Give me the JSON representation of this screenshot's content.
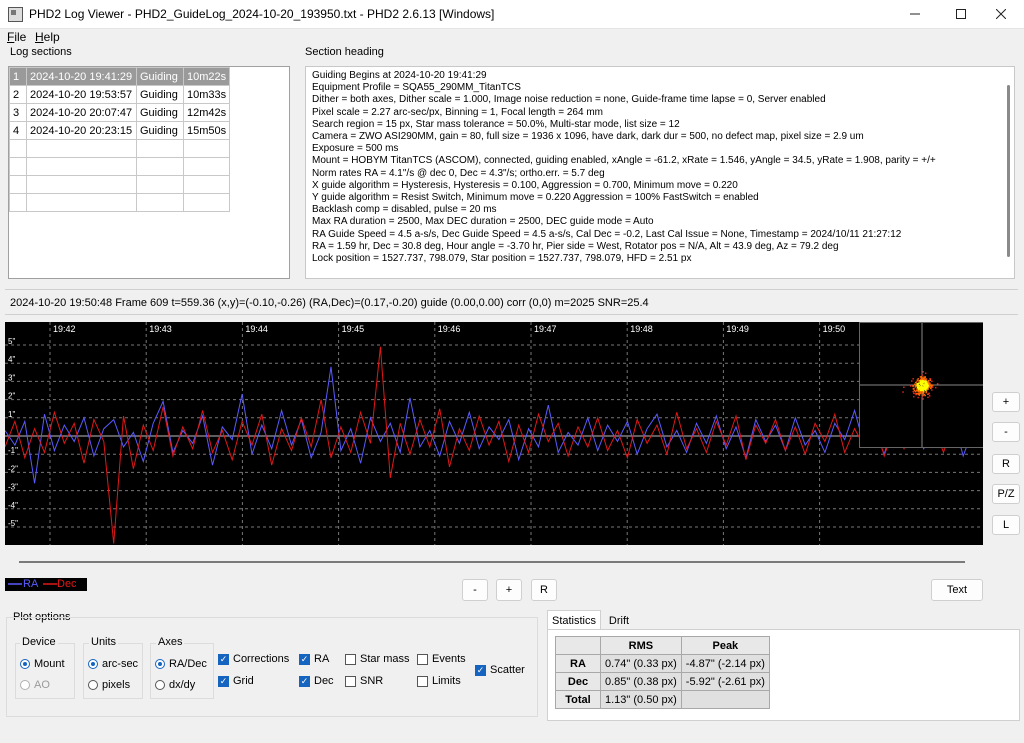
{
  "window": {
    "title": "PHD2 Log Viewer - PHD2_GuideLog_2024-10-20_193950.txt - PHD2 2.6.13 [Windows]",
    "minimize_icon": "minimize-icon",
    "maximize_icon": "maximize-icon",
    "close_icon": "close-icon"
  },
  "menu": {
    "file_rest": "ile",
    "file_key": "F",
    "help_rest": "elp",
    "help_key": "H"
  },
  "log_sections": {
    "label": "Log sections",
    "rows": [
      {
        "num": "1",
        "date": "2024-10-20 19:41:29",
        "type": "Guiding",
        "dur": "10m22s"
      },
      {
        "num": "2",
        "date": "2024-10-20 19:53:57",
        "type": "Guiding",
        "dur": "10m33s"
      },
      {
        "num": "3",
        "date": "2024-10-20 20:07:47",
        "type": "Guiding",
        "dur": "12m42s"
      },
      {
        "num": "4",
        "date": "2024-10-20 20:23:15",
        "type": "Guiding",
        "dur": "15m50s"
      }
    ]
  },
  "section_heading": {
    "label": "Section heading",
    "lines": [
      "Guiding Begins at 2024-10-20 19:41:29",
      "Equipment Profile = SQA55_290MM_TitanTCS",
      "Dither = both axes, Dither scale = 1.000, Image noise reduction = none, Guide-frame time lapse = 0, Server enabled",
      "Pixel scale = 2.27 arc-sec/px, Binning = 1, Focal length = 264 mm",
      "Search region = 15 px, Star mass tolerance = 50.0%, Multi-star mode, list size = 12",
      " Camera = ZWO ASI290MM, gain = 80, full size = 1936 x 1096, have dark, dark dur = 500, no defect map, pixel size = 2.9 um",
      "Exposure = 500 ms",
      "Mount = HOBYM TitanTCS (ASCOM), connected, guiding enabled, xAngle = -61.2, xRate = 1.546, yAngle = 34.5, yRate = 1.908, parity = +/+",
      "Norm rates RA = 4.1\"/s @ dec 0, Dec = 4.3\"/s; ortho.err. = 5.7 deg",
      "X guide algorithm = Hysteresis, Hysteresis = 0.100, Aggression = 0.700, Minimum move = 0.220",
      "Y guide algorithm = Resist Switch, Minimum move = 0.220 Aggression = 100% FastSwitch = enabled",
      "Backlash comp = disabled, pulse = 20 ms",
      "Max RA duration = 2500, Max DEC duration = 2500, DEC guide mode = Auto",
      "RA Guide Speed = 4.5 a-s/s, Dec Guide Speed = 4.5 a-s/s, Cal Dec = -0.2, Last Cal Issue = None, Timestamp = 2024/10/11 21:27:12",
      "RA = 1.59 hr, Dec = 30.8 deg, Hour angle = -3.70 hr, Pier side = West, Rotator pos = N/A, Alt = 43.9 deg, Az = 79.2 deg",
      "Lock position = 1527.737, 798.079, Star position = 1527.737, 798.079, HFD = 2.51 px"
    ]
  },
  "status_line": "2024-10-20 19:50:48 Frame 609 t=559.36 (x,y)=(-0.10,-0.26) (RA,Dec)=(0.17,-0.20) guide (0.00,0.00) corr (0,0) m=2025 SNR=25.4",
  "chart_data": {
    "type": "line",
    "x_ticks": [
      "19:42",
      "19:43",
      "19:44",
      "19:45",
      "19:46",
      "19:47",
      "19:48",
      "19:49",
      "19:50"
    ],
    "y_ticks": [
      "5\"",
      "4\"",
      "3\"",
      "2\"",
      "1\"",
      "",
      "-1\"",
      "-2\"",
      "-3\"",
      "-4\"",
      "-5\""
    ],
    "ylim": [
      -6,
      6
    ],
    "series": [
      {
        "name": "RA",
        "color": "#5a5aff",
        "values": [
          0.3,
          -0.5,
          0.8,
          -2.6,
          1.2,
          -0.8,
          0.6,
          -0.3,
          1.0,
          -1.1,
          0.4,
          0.9,
          -0.6,
          0.2,
          -1.4,
          0.7,
          1.9,
          -0.9,
          0.3,
          -0.4,
          1.1,
          -1.6,
          0.5,
          -0.2,
          2.3,
          -1.0,
          0.6,
          -0.7,
          1.4,
          -0.5,
          0.9,
          -1.2,
          0.2,
          3.8,
          -0.8,
          0.4,
          -1.5,
          1.0,
          -0.3,
          0.7,
          -0.9,
          2.1,
          -0.6,
          0.3,
          -1.1,
          0.8,
          -0.4,
          1.3,
          -0.7,
          0.5,
          -0.2,
          0.9,
          -1.3,
          0.4,
          -0.6,
          1.7,
          -0.9,
          0.2,
          -0.5,
          1.0,
          -0.8,
          0.6,
          -0.3,
          0.8,
          -1.0,
          0.4,
          1.2,
          -0.6,
          0.3,
          -0.9,
          0.7,
          -0.4,
          1.1,
          -0.7,
          0.5,
          -1.2,
          0.9,
          -0.3,
          0.6,
          -0.8,
          1.0,
          -0.5,
          0.3,
          -0.9,
          0.7,
          -0.2,
          1.4,
          -0.6,
          0.4,
          -1.0,
          0.8,
          -0.4,
          0.6,
          -0.7,
          0.5,
          -0.3,
          0.9,
          -1.1,
          0.4,
          -0.5
        ]
      },
      {
        "name": "Dec",
        "color": "#e01818",
        "values": [
          -0.6,
          0.8,
          -1.2,
          0.4,
          -0.9,
          1.3,
          -0.4,
          0.7,
          -1.5,
          0.9,
          -0.3,
          -5.9,
          1.1,
          -1.8,
          0.6,
          -0.8,
          1.6,
          -1.1,
          0.5,
          -0.7,
          1.4,
          -0.9,
          0.3,
          -1.3,
          0.8,
          -0.5,
          1.2,
          -1.6,
          0.4,
          -0.8,
          1.0,
          -0.6,
          2.0,
          -1.2,
          0.5,
          -0.9,
          1.3,
          -0.4,
          4.9,
          -2.3,
          0.7,
          -1.0,
          0.9,
          -0.6,
          1.5,
          -1.7,
          0.4,
          -0.8,
          1.1,
          -0.5,
          0.8,
          -1.4,
          0.6,
          -0.9,
          1.2,
          -0.3,
          0.7,
          -1.1,
          0.5,
          -0.6,
          1.0,
          -0.8,
          0.3,
          -1.2,
          0.9,
          -0.4,
          0.6,
          -1.0,
          1.3,
          -0.7,
          0.4,
          -0.9,
          0.8,
          -0.5,
          1.1,
          -1.3,
          0.6,
          -0.4,
          0.9,
          -0.8,
          0.5,
          -1.0,
          0.7,
          -0.3,
          1.2,
          -0.9,
          0.4,
          -0.6,
          0.8,
          -1.1,
          0.5,
          -0.7,
          1.0,
          -0.4,
          0.6,
          -0.9,
          0.8,
          -0.5,
          0.7,
          -0.6
        ]
      }
    ]
  },
  "legend": {
    "ra": "RA",
    "dec": "Dec",
    "ra_color": "#5a5aff",
    "dec_color": "#e01818"
  },
  "side_buttons": {
    "plus": "+",
    "minus": "-",
    "r": "R",
    "pz": "P/Z",
    "l": "L"
  },
  "bottom_buttons": {
    "minus": "-",
    "plus": "+",
    "r": "R",
    "text": "Text"
  },
  "plot_options": {
    "label": "Plot options",
    "device": {
      "label": "Device",
      "mount": "Mount",
      "ao": "AO",
      "mount_selected": true,
      "ao_enabled": false
    },
    "units": {
      "label": "Units",
      "arcsec": "arc-sec",
      "pixels": "pixels",
      "arcsec_selected": true
    },
    "axes": {
      "label": "Axes",
      "radec": "RA/Dec",
      "dxdy": "dx/dy",
      "radec_selected": true
    },
    "checks": {
      "corrections": "Corrections",
      "grid": "Grid",
      "ra": "RA",
      "dec": "Dec",
      "star_mass": "Star mass",
      "snr": "SNR",
      "events": "Events",
      "limits": "Limits",
      "scatter": "Scatter"
    }
  },
  "statistics": {
    "tab_stats": "Statistics",
    "tab_drift": "Drift",
    "headers": [
      "RMS",
      "Peak"
    ],
    "rows": [
      {
        "label": "RA",
        "rms": "0.74\" (0.33 px)",
        "peak": "-4.87\" (-2.14 px)"
      },
      {
        "label": "Dec",
        "rms": "0.85\" (0.38 px)",
        "peak": "-5.92\" (-2.61 px)"
      },
      {
        "label": "Total",
        "rms": "1.13\" (0.50 px)",
        "peak": ""
      }
    ]
  }
}
